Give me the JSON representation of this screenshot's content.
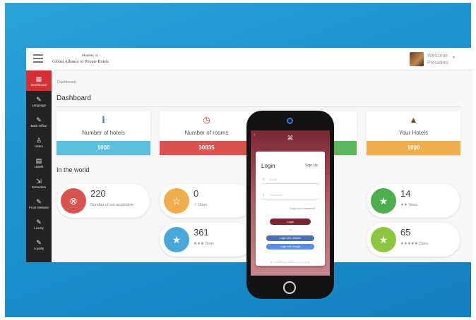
{
  "header": {
    "member_of": "Member of",
    "alliance": "Global Alliance of Private Hotels",
    "welcome": "Welcome",
    "user_role": "President",
    "caret": "▾"
  },
  "sidebar": {
    "items": [
      {
        "label": "Dashboard",
        "icon": "dashboard-grid-icon",
        "glyph": "▦"
      },
      {
        "label": "Language",
        "icon": "pencil-icon",
        "glyph": "✎"
      },
      {
        "label": "Back Office",
        "icon": "pencil-icon",
        "glyph": "✎"
      },
      {
        "label": "Users",
        "icon": "user-icon",
        "glyph": "♙"
      },
      {
        "label": "Hotels",
        "icon": "hotel-icon",
        "glyph": "▤"
      },
      {
        "label": "Extraction",
        "icon": "export-icon",
        "glyph": "⇲"
      },
      {
        "label": "Front Website",
        "icon": "pencil-icon",
        "glyph": "✎"
      },
      {
        "label": "Luxury",
        "icon": "pencil-icon",
        "glyph": "✎"
      },
      {
        "label": "Loyalty",
        "icon": "pencil-icon",
        "glyph": "✎"
      }
    ]
  },
  "main": {
    "breadcrumb": "Dashboard",
    "title": "Dashboard",
    "stat_cards": [
      {
        "label": "Number of hotels",
        "value": "1000",
        "color": "#5bc0de",
        "icon_color": "#2c6fa8",
        "glyph": "ℹ",
        "icon": "info-icon"
      },
      {
        "label": "Number of rooms",
        "value": "30835",
        "color": "#d9534f",
        "icon_color": "#c9302c",
        "glyph": "◷",
        "icon": "clock-icon"
      },
      {
        "label": "",
        "value": "",
        "color": "#5cb85c",
        "icon_color": "#4cae4c",
        "glyph": "",
        "icon": "hidden-icon"
      },
      {
        "label": "Your Hotels",
        "value": "1000",
        "color": "#f0ad4e",
        "icon_color": "#6b4a1a",
        "glyph": "▲",
        "icon": "warning-icon"
      }
    ],
    "world_title": "In the world",
    "world_pills": [
      {
        "number": "220",
        "label": "Number of not applicable",
        "color": "#d9534f",
        "glyph": "⊗",
        "icon": "cancel-icon"
      },
      {
        "number": "0",
        "label": "☆ Stars",
        "color": "#f0ad4e",
        "glyph": "☆",
        "icon": "star-outline-icon"
      },
      {
        "number": "14",
        "label": "★★ Stars",
        "color": "#4cae4c",
        "glyph": "★",
        "icon": "star-icon"
      },
      {
        "number": "361",
        "label": "★★★ Stars",
        "color": "#4aa8d8",
        "glyph": "★",
        "icon": "star-icon"
      },
      {
        "number": "65",
        "label": "★★★★★ Stars",
        "color": "#8cc63f",
        "glyph": "★",
        "icon": "star-icon"
      }
    ]
  },
  "phone": {
    "back_glyph": "‹",
    "logo_glyph": "⌘",
    "login_title": "Login",
    "signup": "Sign Up",
    "email_placeholder": "Email",
    "password_placeholder": "Password",
    "forgot": "Forgot your password?",
    "login_button": "Login",
    "or": "or",
    "linkedin_button": "Login with LinkedIn",
    "google_button": "Login with Google",
    "linkedin_color": "#4a6fb5",
    "google_color": "#5b8de6",
    "fine_print": "By continuing you accept the terms of use"
  }
}
